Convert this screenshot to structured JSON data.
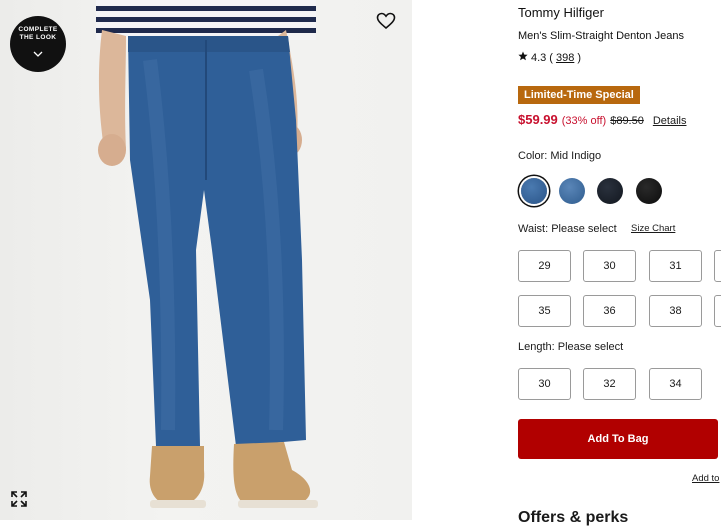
{
  "image": {
    "complete_look_line1": "COMPLETE",
    "complete_look_line2": "THE LOOK",
    "favorite_icon": "heart-outline-icon",
    "expand_icon": "expand-arrows-icon"
  },
  "product": {
    "brand": "Tommy Hilfiger",
    "name": "Men's Slim-Straight Denton Jeans",
    "rating": "4.3",
    "review_count": "398",
    "promo_badge": "Limited-Time Special",
    "price_now": "$59.99",
    "price_discount": "(33% off)",
    "price_was": "$89.50",
    "details_label": "Details"
  },
  "color": {
    "label": "Color: Mid Indigo",
    "swatches": [
      {
        "name": "Mid Indigo",
        "hex": "#2f5b8f",
        "selected": true
      },
      {
        "name": "Medium Blue",
        "hex": "#3a6a9e",
        "selected": false
      },
      {
        "name": "Dark Navy",
        "hex": "#151b24",
        "selected": false
      },
      {
        "name": "Black",
        "hex": "#111111",
        "selected": false
      }
    ]
  },
  "waist": {
    "label": "Waist: Please select",
    "size_chart": "Size Chart",
    "row1": [
      "29",
      "30",
      "31"
    ],
    "row2": [
      "35",
      "36",
      "38"
    ]
  },
  "length": {
    "label": "Length: Please select",
    "options": [
      "30",
      "32",
      "34"
    ]
  },
  "actions": {
    "add_to_bag": "Add To Bag",
    "add_to": "Add to",
    "offers_heading": "Offers & perks"
  },
  "colors": {
    "accent_red": "#b10000",
    "price_red": "#c8102e",
    "promo_orange": "#b8680e"
  }
}
